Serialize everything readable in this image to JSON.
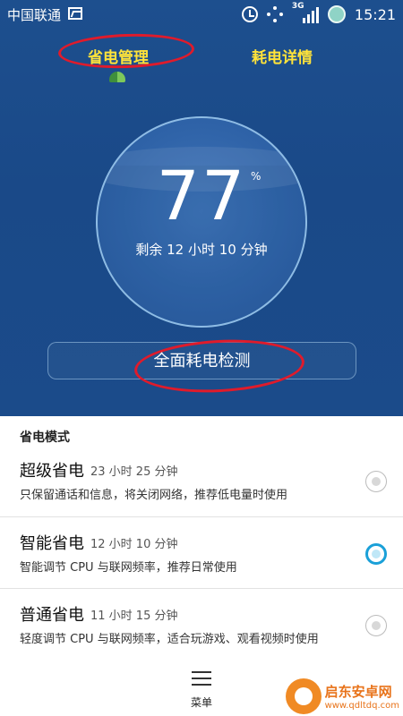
{
  "status_bar": {
    "carrier": "中国联通",
    "time": "15:21",
    "network_type": "3G"
  },
  "tabs": {
    "manage": "省电管理",
    "detail": "耗电详情",
    "active": "manage"
  },
  "gauge": {
    "percent": "77",
    "unit": "%",
    "remaining": "剩余 12 小时 10 分钟",
    "level": 0.77
  },
  "check_button": {
    "label": "全面耗电检测"
  },
  "modes": {
    "section_title": "省电模式",
    "items": [
      {
        "name": "超级省电",
        "duration": "23 小时 25 分钟",
        "description": "只保留通话和信息，将关闭网络，推荐低电量时使用",
        "selected": false
      },
      {
        "name": "智能省电",
        "duration": "12 小时 10 分钟",
        "description": "智能调节 CPU 与联网频率，推荐日常使用",
        "selected": true
      },
      {
        "name": "普通省电",
        "duration": "11 小时 15 分钟",
        "description": "轻度调节 CPU 与联网频率，适合玩游戏、观看视频时使用",
        "selected": false
      }
    ]
  },
  "menu": {
    "label": "菜单"
  },
  "watermark": {
    "title": "启东安卓网",
    "url": "www.qdltdq.com"
  },
  "colors": {
    "header_bg": "#1b4b8a",
    "tab_text": "#ffe33a",
    "annotation": "#e01b2b",
    "radio_selected": "#1aa0d8"
  }
}
